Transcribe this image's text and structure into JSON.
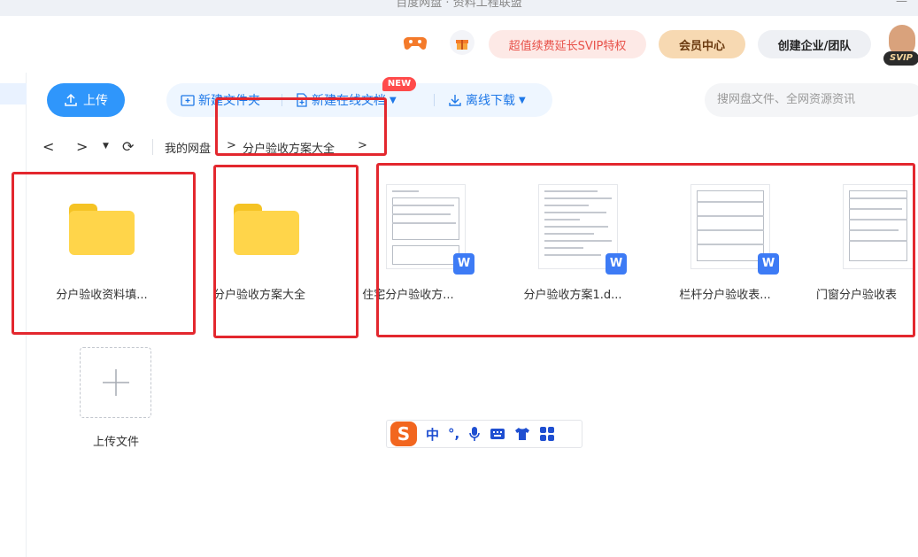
{
  "window": {
    "title": "百度网盘 · 资料工程联盟",
    "minimize_glyph": "—"
  },
  "topbar": {
    "svip_promo": "超值续费延长SVIP特权",
    "member_center": "会员中心",
    "create_team": "创建企业/团队",
    "avatar_badge": "SVIP",
    "icons": [
      "game-controller-icon",
      "gift-icon"
    ]
  },
  "toolbar": {
    "upload": "上传",
    "new_folder": "新建文件夹",
    "new_online_doc": "新建在线文档",
    "new_badge": "NEW",
    "offline_download": "离线下载"
  },
  "search": {
    "placeholder": "搜网盘文件、全网资源资讯"
  },
  "breadcrumb": {
    "root": "我的网盘",
    "current": "分户验收方案大全",
    "sep": ">"
  },
  "files": [
    {
      "name": "分户验收资料填...",
      "kind": "folder"
    },
    {
      "name": "分户验收方案大全",
      "kind": "folder"
    },
    {
      "name": "住宅分户验收方...",
      "kind": "word"
    },
    {
      "name": "分户验收方案1.d...",
      "kind": "word"
    },
    {
      "name": "栏杆分户验收表...",
      "kind": "word"
    },
    {
      "name": "门窗分户验收表",
      "kind": "word"
    }
  ],
  "file_badge": "W",
  "upload_tile": {
    "label": "上传文件"
  },
  "ime": {
    "logo": "S",
    "mode": "中",
    "punct": "°,",
    "items": [
      "microphone-icon",
      "keyboard-icon",
      "shirt-icon",
      "toolbox-icon"
    ]
  },
  "colors": {
    "accent": "#2f96fb",
    "annotation_red": "#e3272e",
    "folder_yellow": "#ffd54a"
  }
}
